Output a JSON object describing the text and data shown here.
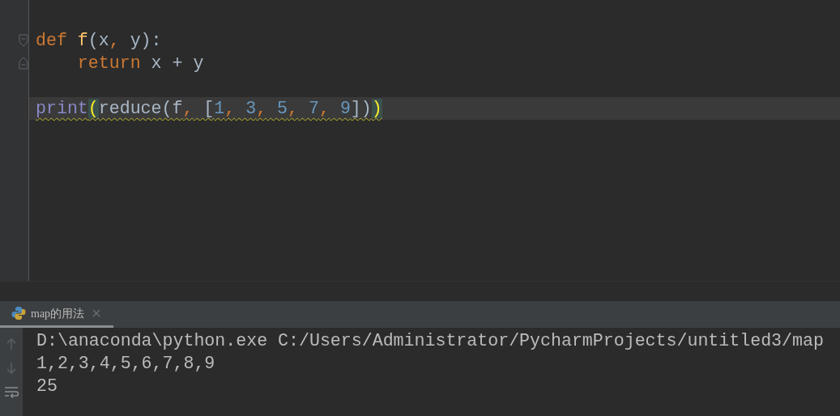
{
  "editor": {
    "lines": [
      {
        "kind": "fold-start",
        "current": false,
        "warning": false,
        "tokens": [
          {
            "text": "def",
            "kind": "keyword"
          },
          {
            "text": " f",
            "kind": "function"
          },
          {
            "text": "(x",
            "kind": "plain"
          },
          {
            "text": ",",
            "kind": "punct"
          },
          {
            "text": " y):",
            "kind": "plain"
          }
        ]
      },
      {
        "kind": "fold-end",
        "current": false,
        "warning": false,
        "tokens": [
          {
            "text": "    return",
            "kind": "keyword"
          },
          {
            "text": " x + y",
            "kind": "plain"
          }
        ]
      },
      {
        "kind": "plain",
        "current": false,
        "warning": false
      },
      {
        "kind": "plain",
        "current": true,
        "warning": true,
        "tokens": [
          {
            "text": "print",
            "kind": "builtin"
          },
          {
            "text": "(",
            "kind": "matched"
          },
          {
            "text": "reduce(f",
            "kind": "plain"
          },
          {
            "text": ",",
            "kind": "punct"
          },
          {
            "text": " [",
            "kind": "plain"
          },
          {
            "text": "1",
            "kind": "number"
          },
          {
            "text": ",",
            "kind": "punct"
          },
          {
            "text": " 3",
            "kind": "number"
          },
          {
            "text": ",",
            "kind": "punct"
          },
          {
            "text": " 5",
            "kind": "number"
          },
          {
            "text": ",",
            "kind": "punct"
          },
          {
            "text": " 7",
            "kind": "number"
          },
          {
            "text": ",",
            "kind": "punct"
          },
          {
            "text": " 9",
            "kind": "number"
          },
          {
            "text": "])",
            "kind": "plain"
          },
          {
            "text": ")",
            "kind": "matched"
          }
        ]
      }
    ]
  },
  "run_panel": {
    "tabs": [
      {
        "label": "map的用法",
        "selected": true
      }
    ],
    "output": [
      "D:\\anaconda\\python.exe C:/Users/Administrator/PycharmProjects/untitled3/map",
      "1,2,3,4,5,6,7,8,9",
      "25"
    ]
  }
}
